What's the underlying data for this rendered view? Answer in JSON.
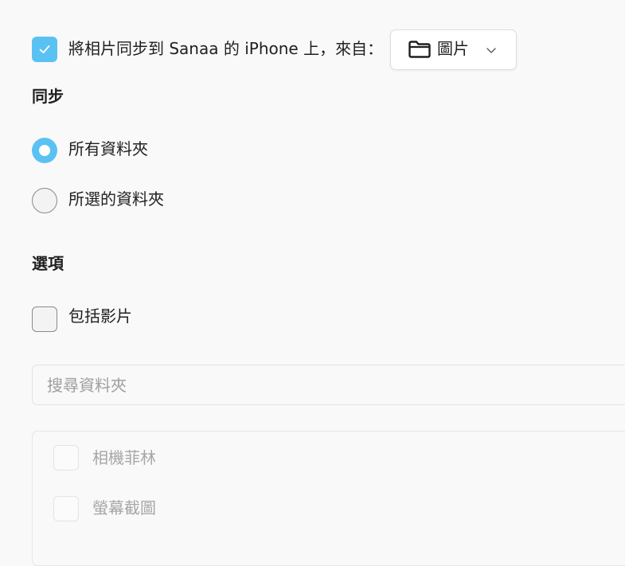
{
  "sync_option": {
    "checked": true,
    "label": "將相片同步到 Sanaa 的 iPhone 上，來自：",
    "source": {
      "icon": "folder-icon",
      "value": "圖片",
      "dropdown_icon": "chevron-down-icon"
    }
  },
  "sync_section": {
    "heading": "同步",
    "options": [
      {
        "label": "所有資料夾",
        "selected": true
      },
      {
        "label": "所選的資料夾",
        "selected": false
      }
    ]
  },
  "options_section": {
    "heading": "選項",
    "include_videos": {
      "label": "包括影片",
      "checked": false
    }
  },
  "search": {
    "placeholder": "搜尋資料夾",
    "value": ""
  },
  "folders": [
    {
      "label": "相機菲林",
      "checked": false,
      "enabled": false
    },
    {
      "label": "螢幕截圖",
      "checked": false,
      "enabled": false
    }
  ],
  "colors": {
    "accent": "#5ac2f3",
    "background": "#f9f9f9",
    "disabled_text": "#a6a6a6"
  }
}
